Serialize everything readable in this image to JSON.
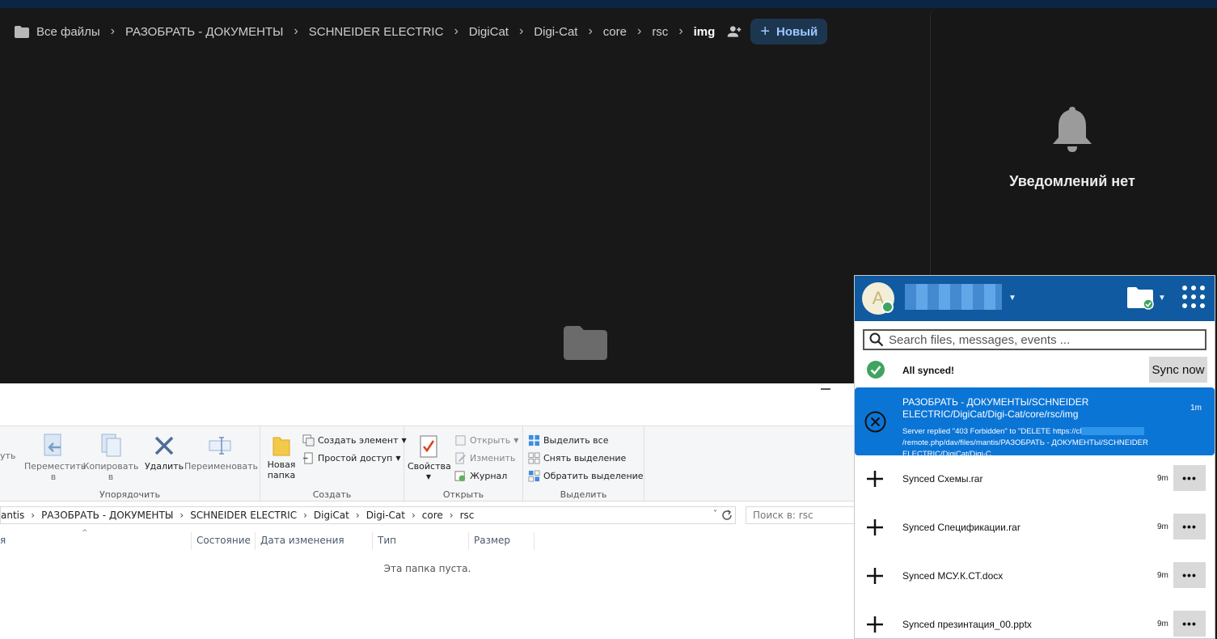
{
  "web": {
    "breadcrumb": {
      "root": "Все файлы",
      "items": [
        "РАЗОБРАТЬ - ДОКУМЕНТЫ",
        "SCHNEIDER ELECTRIC",
        "DigiCat",
        "Digi-Cat",
        "core",
        "rsc"
      ],
      "current": "img"
    },
    "new_button": "Новый",
    "notifications_empty": "Уведомлений нет"
  },
  "explorer": {
    "ribbon": {
      "organize": {
        "label": "Упорядочить",
        "move": "Переместить в",
        "copy": "Копировать в",
        "delete": "Удалить",
        "rename": "Переименовать"
      },
      "create": {
        "label": "Создать",
        "new_folder": "Новая папка",
        "new_item": "Создать элемент",
        "easy_access": "Простой доступ"
      },
      "open": {
        "label": "Открыть",
        "properties": "Свойства",
        "open": "Открыть",
        "edit": "Изменить",
        "history": "Журнал"
      },
      "select": {
        "label": "Выделить",
        "select_all": "Выделить все",
        "select_none": "Снять выделение",
        "invert": "Обратить выделение"
      },
      "cut_label": "уть"
    },
    "address": [
      "antis",
      "РАЗОБРАТЬ - ДОКУМЕНТЫ",
      "SCHNEIDER ELECTRIC",
      "DigiCat",
      "Digi-Cat",
      "core",
      "rsc"
    ],
    "search_placeholder": "Поиск в: rsc",
    "columns": [
      "я",
      "Состояние",
      "Дата изменения",
      "Тип",
      "Размер"
    ],
    "empty_message": "Эта папка пуста."
  },
  "client": {
    "avatar_letter": "A",
    "search_placeholder": "Search files, messages, events ...",
    "status": "All synced!",
    "sync_now": "Sync now",
    "error_item": {
      "title": "РАЗОБРАТЬ - ДОКУМЕНТЫ/SCHNEIDER ELECTRIC/DigiCat/Digi-Cat/core/rsc/img",
      "time": "1m",
      "detail_prefix": "Server replied \"403 Forbidden\" to \"DELETE https://cl",
      "detail_suffix": "/remote.php/dav/files/mantis/РАЗОБРАТЬ - ДОКУМЕНТЫ/SCHNEIDER ELECTRIC/DigiCat/Digi-C..."
    },
    "activities": [
      {
        "text": "Synced Схемы.rar",
        "time": "9m"
      },
      {
        "text": "Synced Спецификации.rar",
        "time": "9m"
      },
      {
        "text": "Synced МСУ.К.СТ.docx",
        "time": "9m"
      },
      {
        "text": "Synced презинтация_00.pptx",
        "time": "9m"
      }
    ],
    "more_label": "•••"
  },
  "colors": {
    "client_header": "#0f5aa0",
    "error_item": "#0b75d6",
    "web_bg": "#181818",
    "new_button_text": "#9ec8ff",
    "synced_green": "#3fa45f"
  }
}
